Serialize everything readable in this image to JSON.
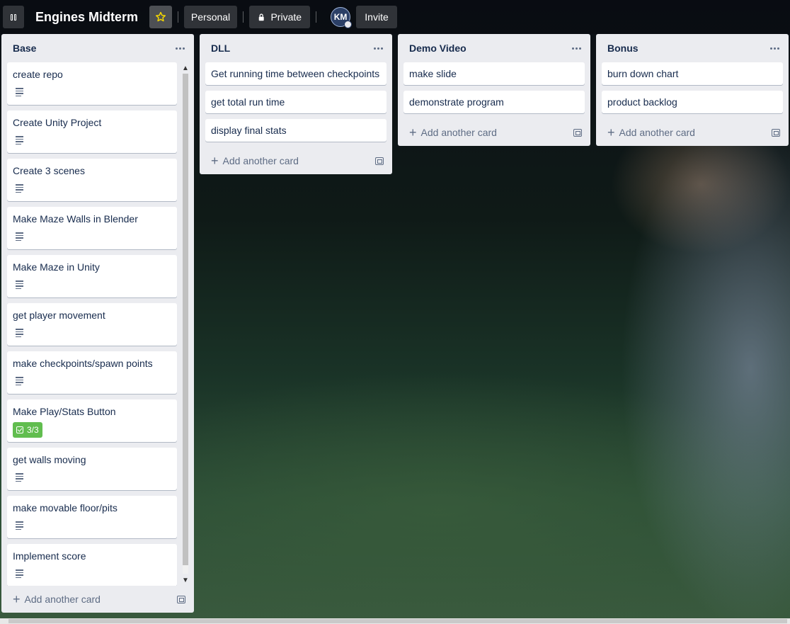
{
  "header": {
    "title": "Engines Midterm",
    "visibility_workspace": "Personal",
    "visibility_privacy": "Private",
    "avatar_initials": "KM",
    "invite_label": "Invite",
    "icons": [
      "board-switch-icon",
      "star-icon",
      "lock-icon"
    ],
    "star_color": "#f2d600"
  },
  "lists": {
    "base": {
      "title": "Base",
      "cards": [
        {
          "title": "create repo",
          "has_description": true
        },
        {
          "title": "Create Unity Project",
          "has_description": true
        },
        {
          "title": "Create 3 scenes",
          "has_description": true
        },
        {
          "title": "Make Maze Walls in Blender",
          "has_description": true
        },
        {
          "title": "Make Maze in Unity",
          "has_description": true
        },
        {
          "title": "get player movement",
          "has_description": true
        },
        {
          "title": "make checkpoints/spawn points",
          "has_description": true
        },
        {
          "title": "Make Play/Stats Button",
          "checklist": "3/3"
        },
        {
          "title": "get walls moving",
          "has_description": true
        },
        {
          "title": "make movable floor/pits",
          "has_description": true
        },
        {
          "title": "Implement score",
          "has_description": true
        }
      ],
      "add_card_label": "Add another card"
    },
    "dll": {
      "title": "DLL",
      "cards": [
        {
          "title": "Get running time between checkpoints"
        },
        {
          "title": "get total run time"
        },
        {
          "title": "display final stats"
        }
      ],
      "add_card_label": "Add another card"
    },
    "demo": {
      "title": "Demo Video",
      "cards": [
        {
          "title": "make slide"
        },
        {
          "title": "demonstrate program"
        }
      ],
      "add_card_label": "Add another card"
    },
    "bonus": {
      "title": "Bonus",
      "cards": [
        {
          "title": "burn down chart"
        },
        {
          "title": "product backlog"
        }
      ],
      "add_card_label": "Add another card"
    }
  },
  "colors": {
    "list_bg": "#ebecf0",
    "card_text": "#172b4d",
    "checklist_complete": "#61bd4f"
  }
}
